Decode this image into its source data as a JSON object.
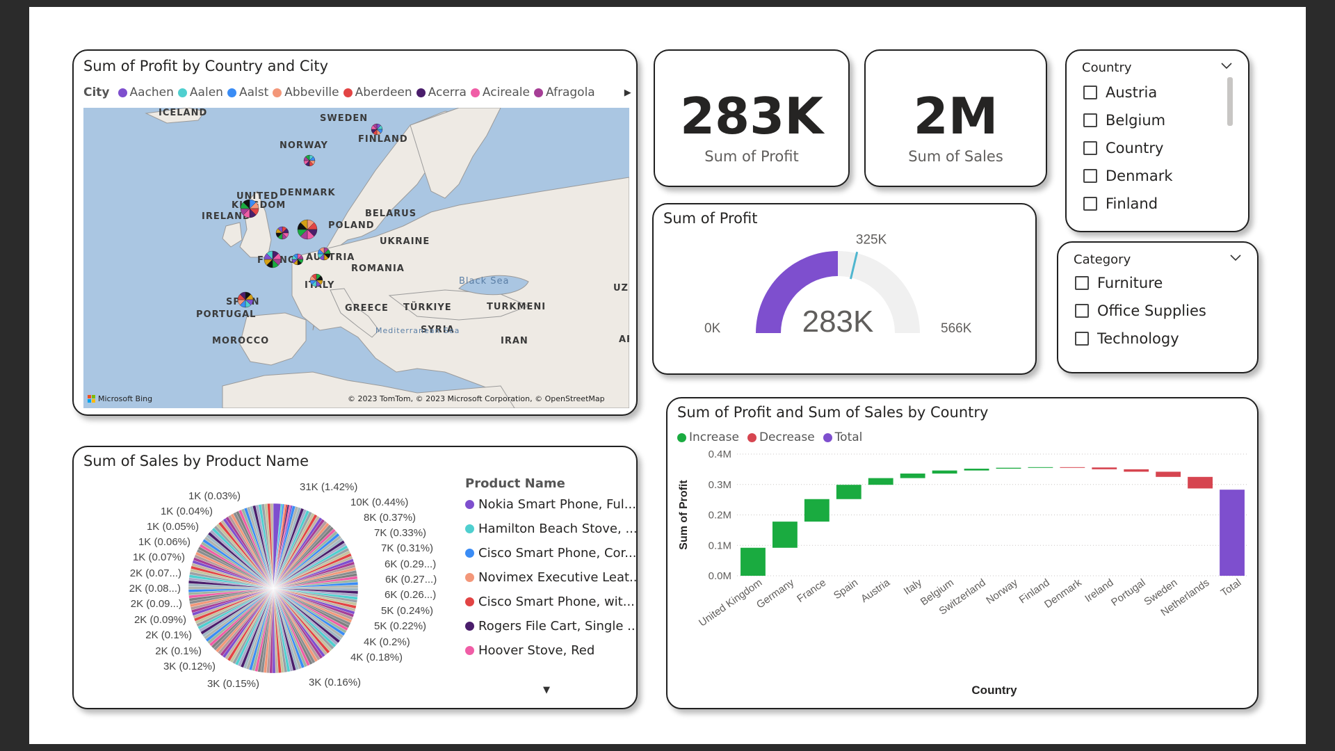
{
  "map": {
    "title": "Sum of Profit by Country and City",
    "legend_title": "City",
    "legend": [
      {
        "name": "Aachen",
        "color": "#7e4fce"
      },
      {
        "name": "Aalen",
        "color": "#4fcfcf"
      },
      {
        "name": "Aalst",
        "color": "#3a8cf5"
      },
      {
        "name": "Abbeville",
        "color": "#f39779"
      },
      {
        "name": "Aberdeen",
        "color": "#e24444"
      },
      {
        "name": "Acerra",
        "color": "#4a1d6b"
      },
      {
        "name": "Acireale",
        "color": "#f05da6"
      },
      {
        "name": "Afragola",
        "color": "#a63e96"
      }
    ],
    "labels": {
      "iceland": "ICELAND",
      "sweden": "SWEDEN",
      "finland": "FINLAND",
      "norway": "NORWAY",
      "uk1": "UNITED",
      "uk2": "KINGDOM",
      "denmark": "DENMARK",
      "belarus": "BELARUS",
      "ireland": "IRELAND",
      "poland": "POLAND",
      "ukraine": "UKRAINE",
      "france": "FRANCE",
      "austria": "AUSTRIA",
      "romania": "ROMANIA",
      "italy": "ITALY",
      "spain": "SPAIN",
      "portugal": "PORTUGAL",
      "greece": "GREECE",
      "turkiye": "TÜRKIYE",
      "turkmen": "TURKMENI",
      "uzb": "UZB",
      "syria": "SYRIA",
      "iran": "IRAN",
      "morocco": "MOROCCO",
      "af": "AF",
      "black_sea": "Black Sea",
      "med_sea": "Mediterranean Sea"
    },
    "bing": "Microsoft Bing",
    "attribution": "© 2023 TomTom, © 2023 Microsoft Corporation, © OpenStreetMap"
  },
  "kpi_profit": {
    "value": "283K",
    "label": "Sum of Profit"
  },
  "kpi_sales": {
    "value": "2M",
    "label": "Sum of Sales"
  },
  "gauge": {
    "title": "Sum of Profit",
    "value_label": "283K",
    "min_label": "0K",
    "max_label": "566K",
    "target_label": "325K",
    "value": 283,
    "min": 0,
    "max": 566,
    "target": 325,
    "fill_color": "#7e4fce",
    "track_color": "#f0f0f0",
    "target_color": "#4fb6cf"
  },
  "slicer_country": {
    "title": "Country",
    "items": [
      "Austria",
      "Belgium",
      "Country",
      "Denmark",
      "Finland"
    ]
  },
  "slicer_category": {
    "title": "Category",
    "items": [
      "Furniture",
      "Office Supplies",
      "Technology"
    ]
  },
  "pie": {
    "title": "Sum of Sales by Product Name",
    "legend_title": "Product Name",
    "legend": [
      {
        "name": "Nokia Smart Phone, Ful...",
        "color": "#7e4fce"
      },
      {
        "name": "Hamilton Beach Stove, ...",
        "color": "#4fcfcf"
      },
      {
        "name": "Cisco Smart Phone, Cor...",
        "color": "#3a8cf5"
      },
      {
        "name": "Novimex Executive Leat...",
        "color": "#f39779"
      },
      {
        "name": "Cisco Smart Phone, wit...",
        "color": "#e24444"
      },
      {
        "name": "Rogers File Cart, Single ...",
        "color": "#4a1d6b"
      },
      {
        "name": "Hoover Stove, Red",
        "color": "#f05da6"
      }
    ],
    "left_labels": [
      "1K (0.03%)",
      "1K (0.04%)",
      "1K (0.05%)",
      "1K (0.06%)",
      "1K (0.07%)",
      "2K (0.07...)",
      "2K (0.08...)",
      "2K (0.09...)",
      "2K (0.09%)",
      "2K (0.1%)",
      "2K (0.1%)",
      "3K (0.12%)",
      "3K (0.15%)"
    ],
    "right_labels": [
      "31K (1.42%)",
      "10K (0.44%)",
      "8K (0.37%)",
      "7K (0.33%)",
      "7K (0.31%)",
      "6K (0.29...)",
      "6K (0.27...)",
      "6K (0.26...)",
      "5K (0.24%)",
      "5K (0.22%)",
      "4K (0.2%)",
      "4K (0.18%)",
      "3K (0.16%)"
    ]
  },
  "chart_data": {
    "type": "bar",
    "subtype": "waterfall",
    "title": "Sum of Profit and Sum of Sales by Country",
    "xlabel": "Country",
    "ylabel": "Sum of Profit",
    "legend": [
      {
        "name": "Increase",
        "color": "#1aab40"
      },
      {
        "name": "Decrease",
        "color": "#d64550"
      },
      {
        "name": "Total",
        "color": "#7e4fce"
      }
    ],
    "ylim": [
      0,
      0.4
    ],
    "yticks": [
      "0.0M",
      "0.1M",
      "0.2M",
      "0.3M",
      "0.4M"
    ],
    "grid": true,
    "legend_position": "top-left",
    "categories": [
      "United Kingdom",
      "Germany",
      "France",
      "Spain",
      "Austria",
      "Italy",
      "Belgium",
      "Switzerland",
      "Norway",
      "Finland",
      "Denmark",
      "Ireland",
      "Portugal",
      "Sweden",
      "Netherlands",
      "Total"
    ],
    "values": [
      0.092,
      0.086,
      0.074,
      0.047,
      0.022,
      0.015,
      0.01,
      0.006,
      0.003,
      0.002,
      -0.001,
      -0.006,
      -0.008,
      -0.017,
      -0.038,
      0.283
    ],
    "kinds": [
      "increase",
      "increase",
      "increase",
      "increase",
      "increase",
      "increase",
      "increase",
      "increase",
      "increase",
      "increase",
      "decrease",
      "decrease",
      "decrease",
      "decrease",
      "decrease",
      "total"
    ]
  }
}
